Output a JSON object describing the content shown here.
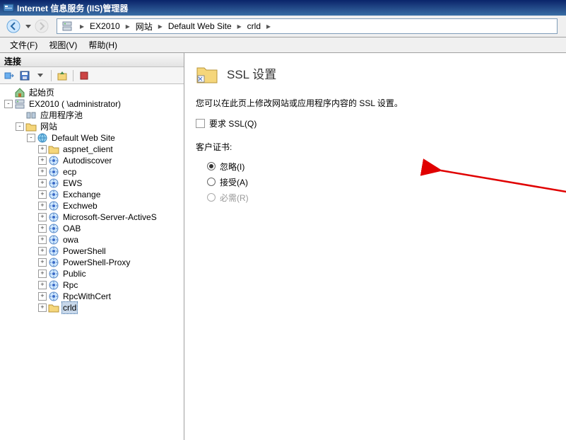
{
  "window": {
    "title": "Internet 信息服务 (IIS)管理器"
  },
  "breadcrumb": {
    "items": [
      "EX2010",
      "网站",
      "Default Web Site",
      "crld"
    ]
  },
  "menubar": {
    "file": "文件(F)",
    "view": "视图(V)",
    "help": "帮助(H)"
  },
  "sidebar": {
    "header": "连接",
    "tree": {
      "start": "起始页",
      "server": "EX2010 (             \\administrator)",
      "apppools": "应用程序池",
      "sites": "网站",
      "defaultSite": "Default Web Site",
      "children": [
        {
          "label": "aspnet_client",
          "icon": "folder"
        },
        {
          "label": "Autodiscover",
          "icon": "app"
        },
        {
          "label": "ecp",
          "icon": "app"
        },
        {
          "label": "EWS",
          "icon": "app"
        },
        {
          "label": "Exchange",
          "icon": "app"
        },
        {
          "label": "Exchweb",
          "icon": "app"
        },
        {
          "label": "Microsoft-Server-ActiveS",
          "icon": "app"
        },
        {
          "label": "OAB",
          "icon": "app"
        },
        {
          "label": "owa",
          "icon": "app"
        },
        {
          "label": "PowerShell",
          "icon": "app"
        },
        {
          "label": "PowerShell-Proxy",
          "icon": "app"
        },
        {
          "label": "Public",
          "icon": "app"
        },
        {
          "label": "Rpc",
          "icon": "app"
        },
        {
          "label": "RpcWithCert",
          "icon": "app"
        },
        {
          "label": "crld",
          "icon": "folder",
          "selected": true
        }
      ]
    }
  },
  "content": {
    "title": "SSL 设置",
    "description": "您可以在此页上修改网站或应用程序内容的 SSL 设置。",
    "requireSsl": {
      "label": "要求 SSL(Q)",
      "checked": false
    },
    "clientCert": {
      "label": "客户证书:",
      "options": [
        {
          "label": "忽略(I)",
          "value": "ignore",
          "checked": true
        },
        {
          "label": "接受(A)",
          "value": "accept",
          "checked": false
        },
        {
          "label": "必需(R)",
          "value": "require",
          "checked": false,
          "disabled": true
        }
      ]
    }
  }
}
